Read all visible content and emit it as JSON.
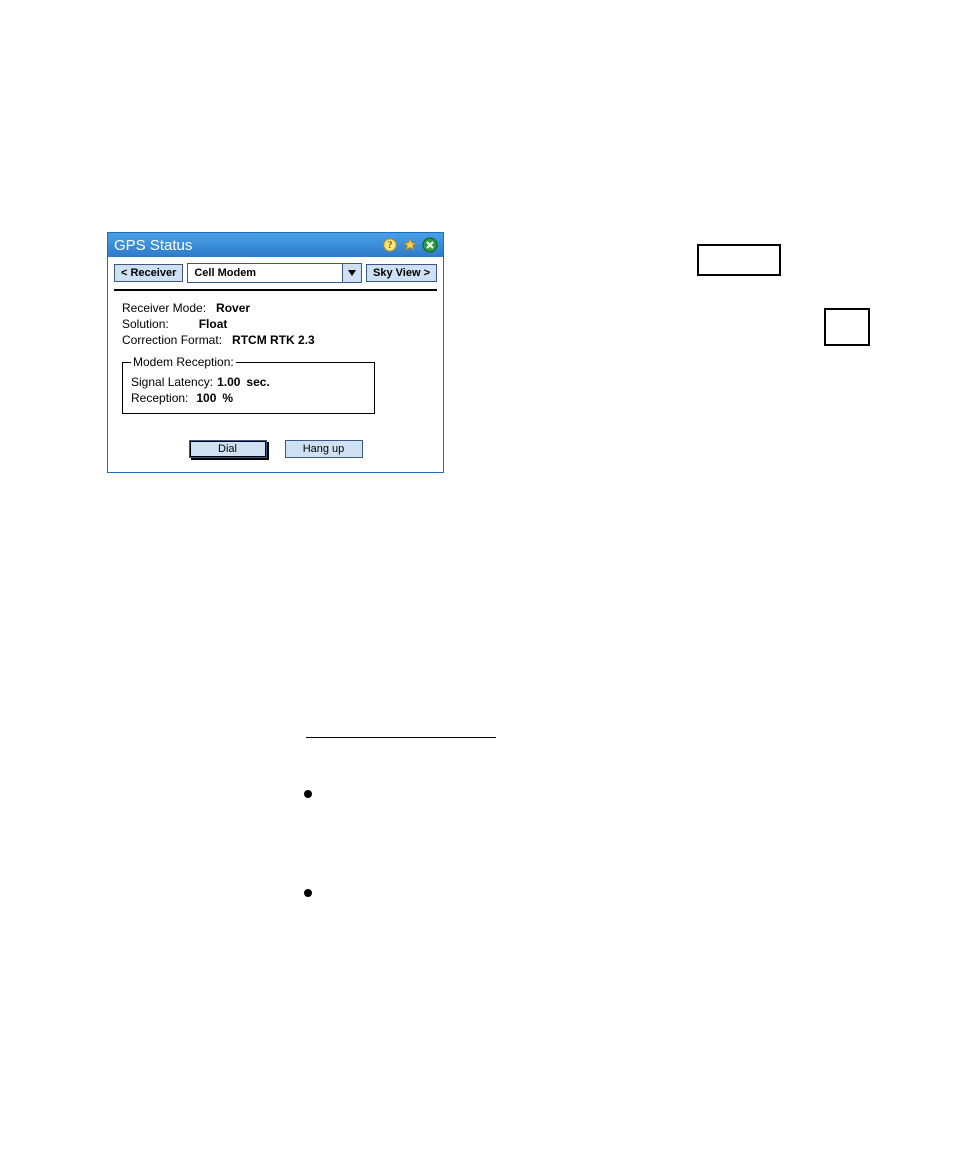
{
  "titlebar": {
    "title": "GPS Status"
  },
  "toolbar": {
    "prev_label": "< Receiver",
    "selected": "Cell Modem",
    "next_label": "Sky View >"
  },
  "status": {
    "receiver_mode_label": "Receiver Mode:",
    "receiver_mode_value": "Rover",
    "solution_label": "Solution:",
    "solution_value": "Float",
    "correction_format_label": "Correction Format:",
    "correction_format_value": "RTCM RTK 2.3"
  },
  "modem": {
    "legend": "Modem Reception:",
    "latency_label": "Signal Latency:",
    "latency_value": "1.00",
    "latency_unit": "sec.",
    "reception_label": "Reception:",
    "reception_value": "100",
    "reception_unit": "%"
  },
  "footer": {
    "dial_label": "Dial",
    "hangup_label": "Hang up"
  }
}
